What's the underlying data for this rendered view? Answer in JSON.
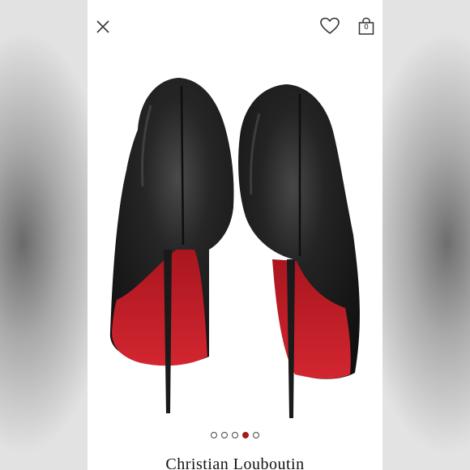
{
  "header": {
    "close_icon": "close-icon",
    "favorite_icon": "heart-icon",
    "bag_icon": "shopping-bag-icon",
    "bag_count": "0"
  },
  "product": {
    "brand": "Christian Louboutin",
    "image_description_icon": "product-photo"
  },
  "carousel": {
    "total": 5,
    "active_index": 3
  },
  "colors": {
    "accent": "#a31a1a",
    "sole_red": "#c8202a",
    "leather": "#1c1c1c"
  }
}
